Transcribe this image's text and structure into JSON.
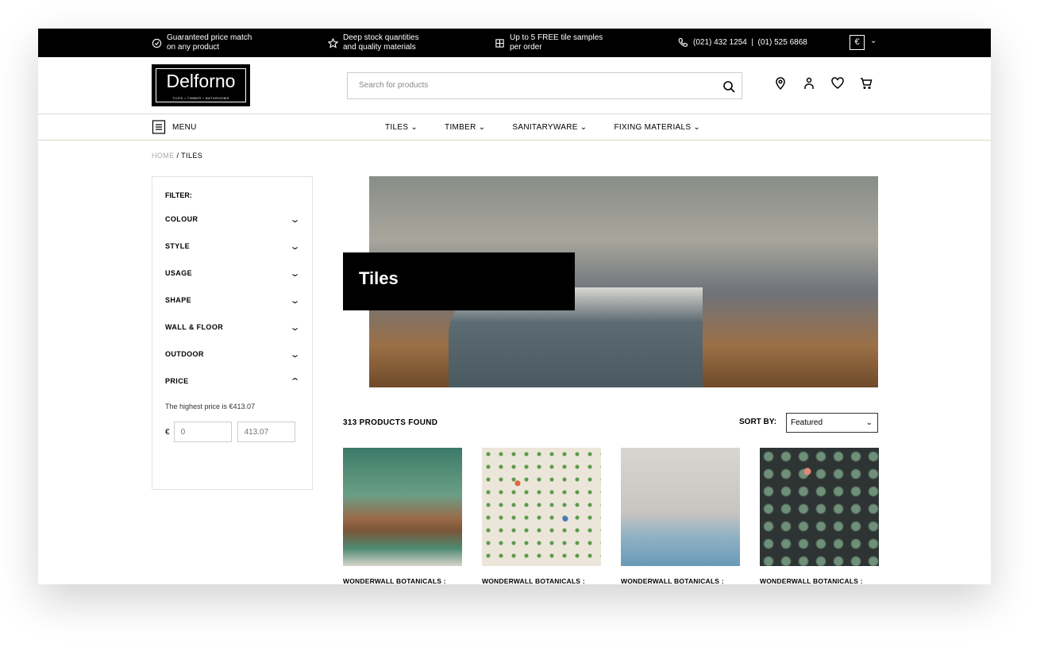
{
  "topbar": {
    "items": [
      {
        "icon": "badge-check-icon",
        "line1": "Guaranteed price match",
        "line2": "on any product"
      },
      {
        "icon": "star-icon",
        "line1": "Deep stock quantities",
        "line2": "and quality materials"
      },
      {
        "icon": "grid-icon",
        "line1": "Up to 5 FREE tile samples",
        "line2": "per order"
      }
    ],
    "phone": "(021) 432 1254  |  (01) 525 6868",
    "currency": "€"
  },
  "logo": {
    "name": "Delforno",
    "tagline": "TILES • TIMBER • BATHROOMS"
  },
  "search": {
    "placeholder": "Search for products"
  },
  "nav": {
    "menu": "MENU",
    "items": [
      "TILES ⌄",
      "TIMBER ⌄",
      "SANITARYWARE ⌄",
      "FIXING MATERIALS ⌄"
    ]
  },
  "breadcrumb": {
    "home": "HOME",
    "sep": " / ",
    "current": "TILES"
  },
  "filter": {
    "title": "FILTER:",
    "groups": [
      "COLOUR",
      "STYLE",
      "USAGE",
      "SHAPE",
      "WALL & FLOOR",
      "OUTDOOR",
      "PRICE"
    ],
    "highest": "The highest price is €413.07",
    "currency": "€",
    "min_placeholder": "0",
    "max_placeholder": "413.07"
  },
  "hero": {
    "title": "Tiles"
  },
  "results": {
    "count": "313 PRODUCTS FOUND",
    "sort_label": "SORT BY:",
    "sort_value": "Featured"
  },
  "products": [
    {
      "title": "WONDERWALL BOTANICALS :"
    },
    {
      "title": "WONDERWALL BOTANICALS :"
    },
    {
      "title": "WONDERWALL BOTANICALS :"
    },
    {
      "title": "WONDERWALL BOTANICALS :"
    }
  ]
}
